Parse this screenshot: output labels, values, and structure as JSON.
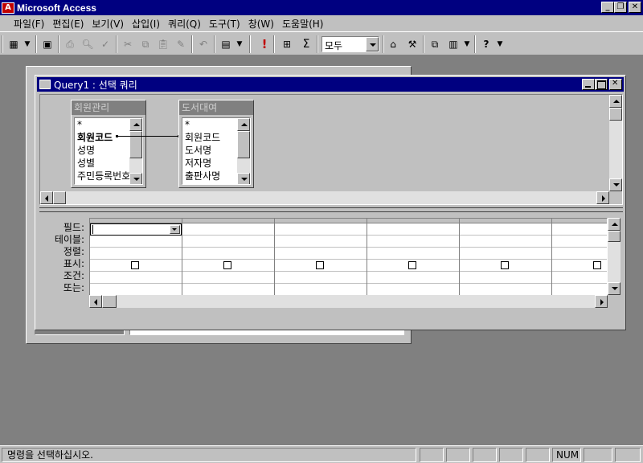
{
  "app": {
    "title": "Microsoft Access",
    "icon": "access-key-icon"
  },
  "menu": [
    "파일(F)",
    "편집(E)",
    "보기(V)",
    "삽입(I)",
    "쿼리(Q)",
    "도구(T)",
    "창(W)",
    "도움말(H)"
  ],
  "toolbar": {
    "view_combo_icon": "datasheet-view-icon",
    "filter_value": "모두",
    "run_symbol": "!",
    "totals_symbol": "Σ"
  },
  "query_window": {
    "title": "Query1 : 선택 쿼리",
    "tables": [
      {
        "name": "회원관리",
        "fields": [
          "*",
          "회원코드",
          "성명",
          "성별",
          "주민등록번호"
        ],
        "bold_index": 1
      },
      {
        "name": "도서대여",
        "fields": [
          "*",
          "회원코드",
          "도서명",
          "저자명",
          "출판사명"
        ]
      }
    ],
    "grid_rows": [
      "필드:",
      "테이블:",
      "정렬:",
      "표시:",
      "조건:",
      "또는:"
    ],
    "grid_column_count": 6
  },
  "status": {
    "message": "명령을 선택하십시오.",
    "num": "NUM"
  }
}
